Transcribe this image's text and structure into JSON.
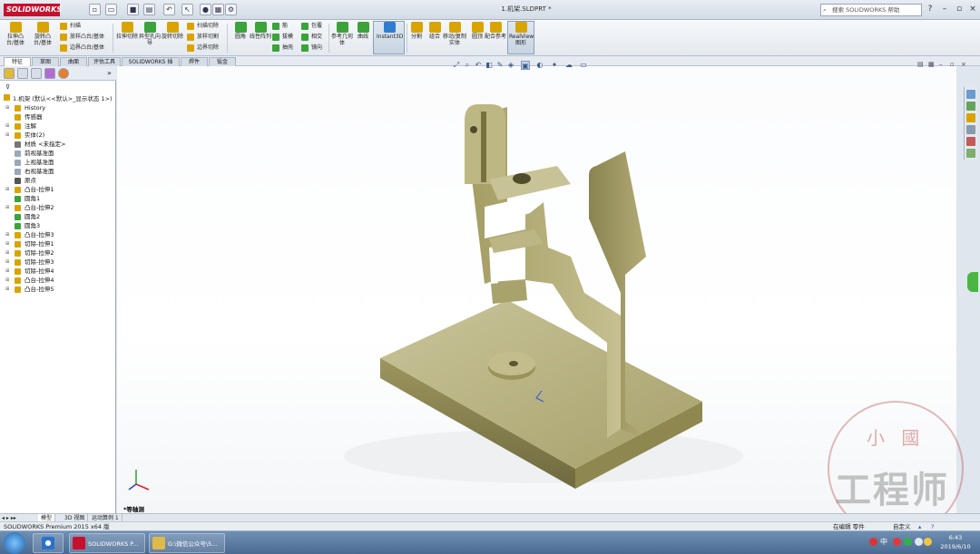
{
  "app": {
    "brand": "SOLIDWORKS",
    "document_title": "1.机架.SLDPRT *",
    "search_placeholder": "搜索 SOLIDWORKS 帮助"
  },
  "toolbar": {
    "big": [
      {
        "label": "拉伸凸台/基体",
        "color": "#d9a400"
      },
      {
        "label": "旋转凸台/基体",
        "color": "#d9a400"
      },
      {
        "label": "拉伸切除",
        "color": "#d9a400"
      },
      {
        "label": "异型孔向导",
        "color": "#3aa33a"
      },
      {
        "label": "旋转切除",
        "color": "#d9a400"
      },
      {
        "label": "圆角",
        "color": "#3aa33a"
      },
      {
        "label": "线性阵列",
        "color": "#3aa33a"
      },
      {
        "label": "参考几何体",
        "color": "#3aa33a"
      },
      {
        "label": "曲线",
        "color": "#3aa33a"
      },
      {
        "label": "Instant3D",
        "color": "#2e7dd1"
      },
      {
        "label": "分割",
        "color": "#d9a400"
      },
      {
        "label": "组合",
        "color": "#d9a400"
      },
      {
        "label": "移动/复制实体",
        "color": "#d9a400"
      },
      {
        "label": "圆顶",
        "color": "#d9a400"
      },
      {
        "label": "配合参考",
        "color": "#d9a400"
      },
      {
        "label": "RealView 图形",
        "color": "#d9a400"
      }
    ],
    "small": [
      {
        "label": "扫描",
        "color": "#d9a400"
      },
      {
        "label": "放样凸台/基体",
        "color": "#d9a400"
      },
      {
        "label": "边界凸台/基体",
        "color": "#d9a400"
      },
      {
        "label": "扫描切除",
        "color": "#d9a400"
      },
      {
        "label": "放样切割",
        "color": "#d9a400"
      },
      {
        "label": "边界切除",
        "color": "#d9a400"
      },
      {
        "label": "筋",
        "color": "#3aa33a"
      },
      {
        "label": "拔模",
        "color": "#3aa33a"
      },
      {
        "label": "抽壳",
        "color": "#3aa33a"
      },
      {
        "label": "包覆",
        "color": "#3aa33a"
      },
      {
        "label": "相交",
        "color": "#3aa33a"
      },
      {
        "label": "镜向",
        "color": "#3aa33a"
      }
    ]
  },
  "tabs": [
    "特征",
    "草图",
    "曲面",
    "评估工具",
    "SOLIDWORKS 插件",
    "焊件(D)",
    "钣金(H)"
  ],
  "tree": {
    "filter_icon": "funnel-icon",
    "root": "1.机架 (默认<<默认>_显示状态 1>)",
    "items": [
      {
        "label": "History",
        "color": "#d9a400",
        "expand": true
      },
      {
        "label": "传感器",
        "color": "#d9a400",
        "expand": false
      },
      {
        "label": "注解",
        "color": "#d9a400",
        "expand": true
      },
      {
        "label": "实体(2)",
        "color": "#d9a400",
        "expand": true
      },
      {
        "label": "材质 <未指定>",
        "color": "#777777",
        "expand": false
      },
      {
        "label": "前视基准面",
        "color": "#9aa8b8",
        "expand": false
      },
      {
        "label": "上视基准面",
        "color": "#9aa8b8",
        "expand": false
      },
      {
        "label": "右视基准面",
        "color": "#9aa8b8",
        "expand": false
      },
      {
        "label": "原点",
        "color": "#555555",
        "expand": false
      },
      {
        "label": "凸台-拉伸1",
        "color": "#d9a400",
        "expand": true
      },
      {
        "label": "圆角1",
        "color": "#3aa33a",
        "expand": false
      },
      {
        "label": "凸台-拉伸2",
        "color": "#d9a400",
        "expand": true
      },
      {
        "label": "圆角2",
        "color": "#3aa33a",
        "expand": false
      },
      {
        "label": "圆角3",
        "color": "#3aa33a",
        "expand": false
      },
      {
        "label": "凸台-拉伸3",
        "color": "#d9a400",
        "expand": true
      },
      {
        "label": "切除-拉伸1",
        "color": "#d9a400",
        "expand": true
      },
      {
        "label": "切除-拉伸2",
        "color": "#d9a400",
        "expand": true
      },
      {
        "label": "切除-拉伸3",
        "color": "#d9a400",
        "expand": true
      },
      {
        "label": "切除-拉伸4",
        "color": "#d9a400",
        "expand": true
      },
      {
        "label": "凸台-拉伸4",
        "color": "#d9a400",
        "expand": true
      },
      {
        "label": "凸台-拉伸5",
        "color": "#d9a400",
        "expand": true
      }
    ]
  },
  "viewport": {
    "view_name": "*等轴测",
    "model_color": "#b6b07a"
  },
  "bottom_tabs": [
    "模型",
    "3D 视图",
    "运动算例 1"
  ],
  "status": {
    "product": "SOLIDWORKS Premium 2015 x64 版",
    "edit_state": "在编辑 零件",
    "units": "自定义"
  },
  "taskbar": {
    "items": [
      {
        "label": "SOLIDWORKS P...",
        "color": "#c8102e"
      },
      {
        "label": "G:\\微信公众号\\5...",
        "color": "#e0b94a"
      }
    ],
    "time": "6:43",
    "date": "2019/6/10",
    "ime": "中"
  },
  "watermark": {
    "line1": "小 國",
    "line2": "工程师"
  }
}
